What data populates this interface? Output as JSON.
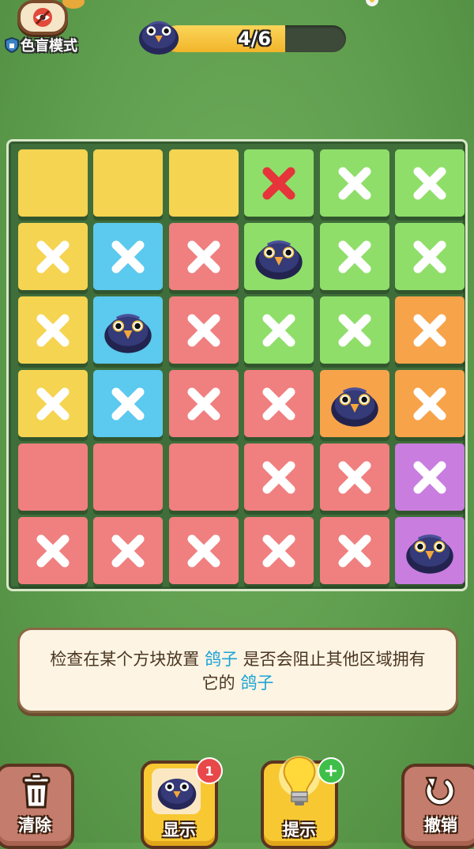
{
  "colorblind": {
    "label": "色盲模式",
    "icon": "eye-off-icon"
  },
  "progress": {
    "text": "4/6",
    "current": 4,
    "total": 6
  },
  "colors": {
    "yellow": "#f5d451",
    "green": "#8fde6a",
    "blue": "#5cc9ee",
    "red": "#f07f7f",
    "orange": "#f7a34a",
    "purple": "#c87ddf",
    "cross_white": "#ffffff",
    "cross_red": "#e6343a"
  },
  "board": {
    "rows": [
      [
        {
          "color": "yellow",
          "mark": "none"
        },
        {
          "color": "yellow",
          "mark": "none"
        },
        {
          "color": "yellow",
          "mark": "none"
        },
        {
          "color": "green",
          "mark": "cross-red"
        },
        {
          "color": "green",
          "mark": "cross"
        },
        {
          "color": "green",
          "mark": "cross"
        }
      ],
      [
        {
          "color": "yellow",
          "mark": "cross"
        },
        {
          "color": "blue",
          "mark": "cross"
        },
        {
          "color": "red",
          "mark": "cross"
        },
        {
          "color": "green",
          "mark": "pigeon"
        },
        {
          "color": "green",
          "mark": "cross"
        },
        {
          "color": "green",
          "mark": "cross"
        }
      ],
      [
        {
          "color": "yellow",
          "mark": "cross"
        },
        {
          "color": "blue",
          "mark": "pigeon"
        },
        {
          "color": "red",
          "mark": "cross"
        },
        {
          "color": "green",
          "mark": "cross"
        },
        {
          "color": "green",
          "mark": "cross"
        },
        {
          "color": "orange",
          "mark": "cross"
        }
      ],
      [
        {
          "color": "yellow",
          "mark": "cross"
        },
        {
          "color": "blue",
          "mark": "cross"
        },
        {
          "color": "red",
          "mark": "cross"
        },
        {
          "color": "red",
          "mark": "cross"
        },
        {
          "color": "orange",
          "mark": "pigeon"
        },
        {
          "color": "orange",
          "mark": "cross"
        }
      ],
      [
        {
          "color": "red",
          "mark": "none"
        },
        {
          "color": "red",
          "mark": "none"
        },
        {
          "color": "red",
          "mark": "none"
        },
        {
          "color": "red",
          "mark": "cross"
        },
        {
          "color": "red",
          "mark": "cross"
        },
        {
          "color": "purple",
          "mark": "cross"
        }
      ],
      [
        {
          "color": "red",
          "mark": "cross"
        },
        {
          "color": "red",
          "mark": "cross"
        },
        {
          "color": "red",
          "mark": "cross"
        },
        {
          "color": "red",
          "mark": "cross"
        },
        {
          "color": "red",
          "mark": "cross"
        },
        {
          "color": "purple",
          "mark": "pigeon"
        }
      ]
    ]
  },
  "hint": {
    "part1": "检查在某个方块放置 ",
    "keyword1": "鸽子",
    "part2": " 是否会阻止其他区域拥有它的 ",
    "keyword2": "鸽子"
  },
  "buttons": {
    "clear": {
      "label": "清除",
      "icon": "trash-icon"
    },
    "show": {
      "label": "显示",
      "icon": "pigeon-icon",
      "badge": "1"
    },
    "tip": {
      "label": "提示",
      "icon": "lightbulb-icon",
      "badge": "+"
    },
    "undo": {
      "label": "撤销",
      "icon": "undo-icon"
    }
  }
}
